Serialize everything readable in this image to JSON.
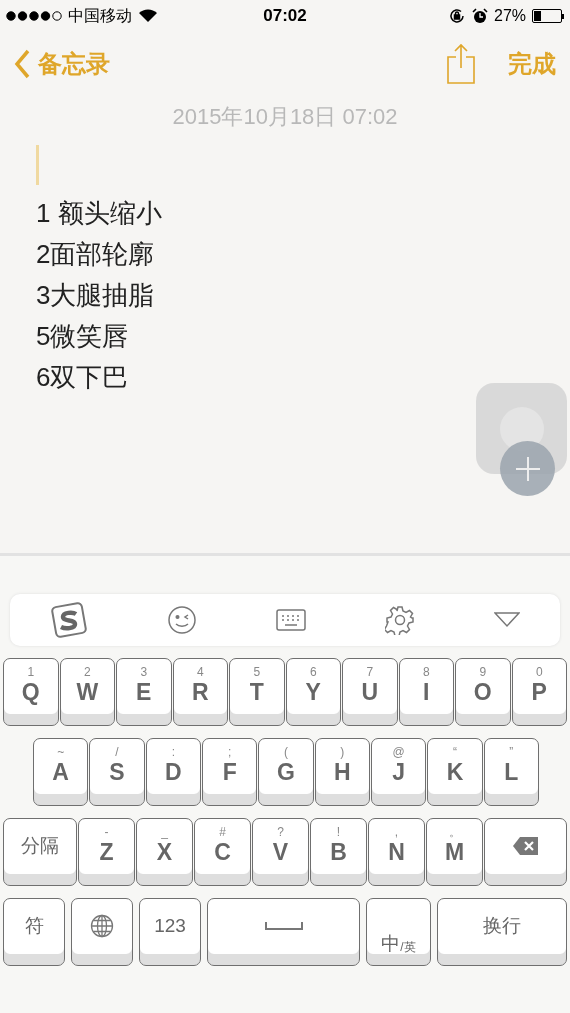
{
  "status_bar": {
    "carrier": "中国移动",
    "time": "07:02",
    "battery": "27%"
  },
  "nav": {
    "back": "备忘录",
    "done": "完成"
  },
  "note": {
    "date": "2015年10月18日 07:02",
    "lines": [
      "1 额头缩小",
      "2面部轮廓",
      "3大腿抽脂",
      "5微笑唇",
      "6双下巴"
    ]
  },
  "keyboard": {
    "top_letter_row": [
      {
        "kind": "letter",
        "hint": "1",
        "label": "Q"
      },
      {
        "kind": "letter",
        "hint": "2",
        "label": "W"
      },
      {
        "kind": "letter",
        "hint": "3",
        "label": "E"
      },
      {
        "kind": "letter",
        "hint": "4",
        "label": "R"
      },
      {
        "kind": "letter",
        "hint": "5",
        "label": "T"
      },
      {
        "kind": "letter",
        "hint": "6",
        "label": "Y"
      },
      {
        "kind": "letter",
        "hint": "7",
        "label": "U"
      },
      {
        "kind": "letter",
        "hint": "8",
        "label": "I"
      },
      {
        "kind": "letter",
        "hint": "9",
        "label": "O"
      },
      {
        "kind": "letter",
        "hint": "0",
        "label": "P"
      }
    ],
    "middle_letter_row": [
      {
        "kind": "letter",
        "hint": "~",
        "label": "A"
      },
      {
        "kind": "letter",
        "hint": "/",
        "label": "S"
      },
      {
        "kind": "letter",
        "hint": ":",
        "label": "D"
      },
      {
        "kind": "letter",
        "hint": ";",
        "label": "F"
      },
      {
        "kind": "letter",
        "hint": "(",
        "label": "G"
      },
      {
        "kind": "letter",
        "hint": ")",
        "label": "H"
      },
      {
        "kind": "letter",
        "hint": "@",
        "label": "J"
      },
      {
        "kind": "letter",
        "hint": "“",
        "label": "K"
      },
      {
        "kind": "letter",
        "hint": "”",
        "label": "L"
      }
    ],
    "bottom_letter_row": [
      {
        "kind": "label",
        "label": "分隔"
      },
      {
        "kind": "letter",
        "hint": "-",
        "label": "Z"
      },
      {
        "kind": "letter",
        "hint": "_",
        "label": "X"
      },
      {
        "kind": "letter",
        "hint": "#",
        "label": "C"
      },
      {
        "kind": "letter",
        "hint": "?",
        "label": "V"
      },
      {
        "kind": "letter",
        "hint": "!",
        "label": "B"
      },
      {
        "kind": "letter",
        "hint": ",",
        "label": "N"
      },
      {
        "kind": "letter",
        "hint": "。",
        "label": "M"
      },
      {
        "kind": "delete"
      }
    ],
    "function_row": [
      {
        "kind": "label",
        "label": "符"
      },
      {
        "kind": "globe"
      },
      {
        "kind": "label",
        "label": "123"
      },
      {
        "kind": "space"
      },
      {
        "kind": "lang",
        "label": "中",
        "sub": "/英"
      },
      {
        "kind": "label",
        "label": "换行"
      }
    ]
  }
}
